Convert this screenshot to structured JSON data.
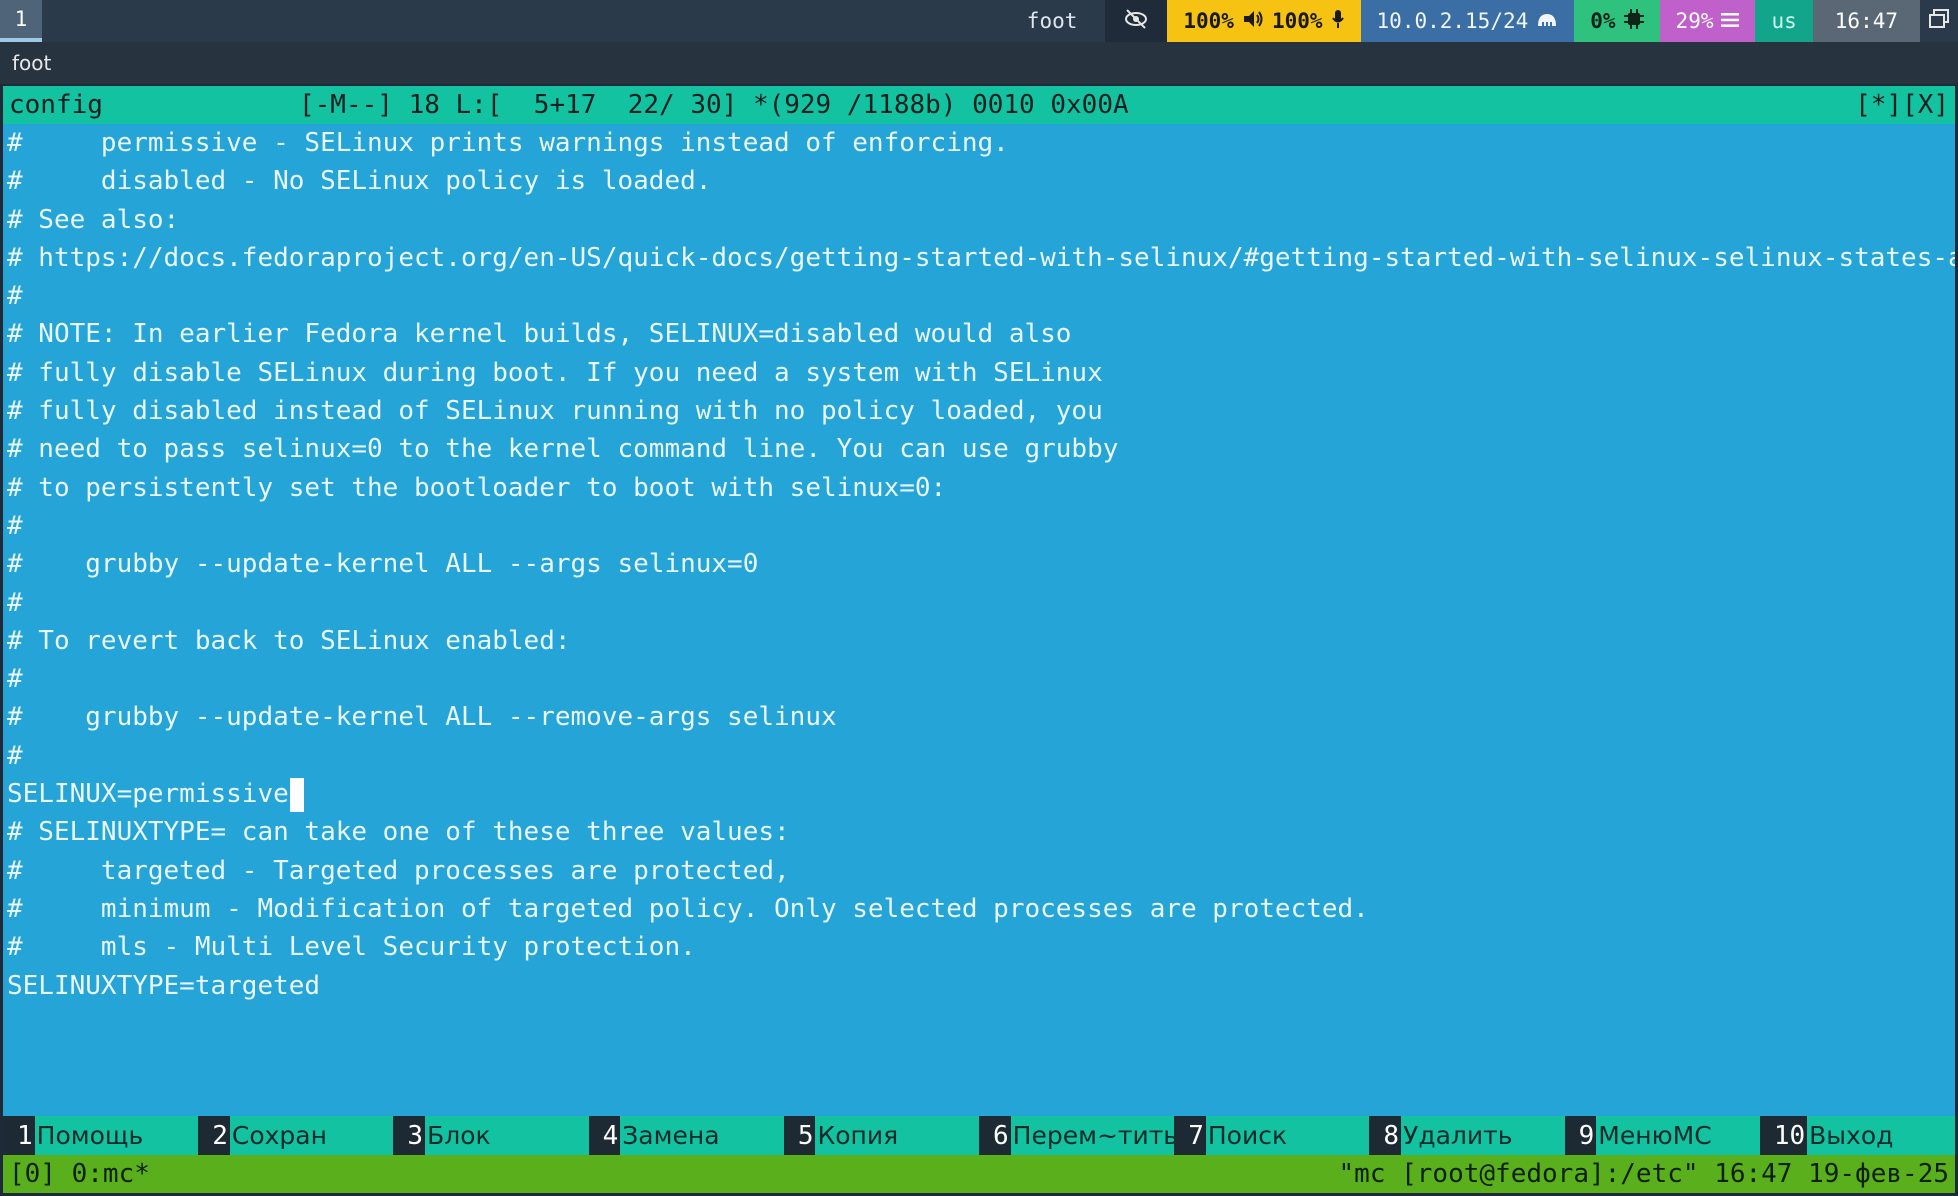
{
  "bar": {
    "workspace": "1",
    "window_title": "foot",
    "volume": "100%",
    "mic": "100%",
    "network": "10.0.2.15/24",
    "cpu": "0%",
    "memory": "29%",
    "keyboard": "us",
    "clock": "16:47"
  },
  "foot_title": "foot",
  "status": {
    "filename": "config",
    "info": "[-M--] 18 L:[  5+17  22/ 30] *(929 /1188b) 0010 0x00A",
    "flags": "[*][X]"
  },
  "editor": {
    "lines": [
      "#     permissive - SELinux prints warnings instead of enforcing.",
      "#     disabled - No SELinux policy is loaded.",
      "# See also:",
      "# https://docs.fedoraproject.org/en-US/quick-docs/getting-started-with-selinux/#getting-started-with-selinux-selinux-states-and",
      "#",
      "# NOTE: In earlier Fedora kernel builds, SELINUX=disabled would also",
      "# fully disable SELinux during boot. If you need a system with SELinux",
      "# fully disabled instead of SELinux running with no policy loaded, you",
      "# need to pass selinux=0 to the kernel command line. You can use grubby",
      "# to persistently set the bootloader to boot with selinux=0:",
      "#",
      "#    grubby --update-kernel ALL --args selinux=0",
      "#",
      "# To revert back to SELinux enabled:",
      "#",
      "#    grubby --update-kernel ALL --remove-args selinux",
      "#",
      "SELINUX=permissive",
      "# SELINUXTYPE= can take one of these three values:",
      "#     targeted - Targeted processes are protected,",
      "#     minimum - Modification of targeted policy. Only selected processes are protected.",
      "#     mls - Multi Level Security protection.",
      "SELINUXTYPE=targeted"
    ]
  },
  "fkeys": [
    {
      "num": "1",
      "label": "Помощь"
    },
    {
      "num": "2",
      "label": "Сохран"
    },
    {
      "num": "3",
      "label": "Блок"
    },
    {
      "num": "4",
      "label": "Замена"
    },
    {
      "num": "5",
      "label": "Копия"
    },
    {
      "num": "6",
      "label": "Перем~тить"
    },
    {
      "num": "7",
      "label": "Поиск"
    },
    {
      "num": "8",
      "label": "Удалить"
    },
    {
      "num": "9",
      "label": "МенюMC"
    },
    {
      "num": "10",
      "label": "Выход"
    }
  ],
  "tmux": {
    "left": "[0] 0:mc*",
    "right": "\"mc [root@fedora]:/etc\" 16:47 19-фев-25"
  },
  "icons": {
    "privacy": "eye-slash-icon",
    "volume": "speaker-icon",
    "mic": "microphone-icon",
    "network": "ethernet-icon",
    "cpu": "cpu-chip-icon",
    "memory": "memory-bars-icon",
    "window": "window-stack-icon"
  },
  "colors": {
    "terminal_bg": "#24a4d7",
    "status_bg": "#13c2a0",
    "tmux_bg": "#5aaf1c"
  }
}
